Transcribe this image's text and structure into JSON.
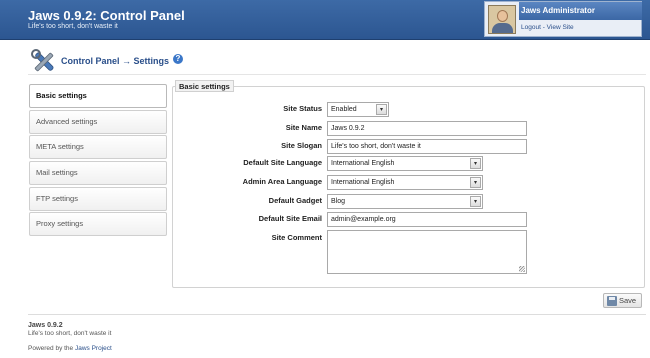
{
  "header": {
    "title": "Jaws 0.9.2: Control Panel",
    "slogan": "Life's too short, don't waste it"
  },
  "user": {
    "name": "Jaws Administrator",
    "logout": "Logout",
    "separator": " - ",
    "view_site": "View Site"
  },
  "breadcrumb": {
    "text": "Control Panel → Settings",
    "help_icon": "?"
  },
  "sidebar": {
    "items": [
      {
        "label": "Basic settings",
        "active": true
      },
      {
        "label": "Advanced settings",
        "active": false
      },
      {
        "label": "META settings",
        "active": false
      },
      {
        "label": "Mail settings",
        "active": false
      },
      {
        "label": "FTP settings",
        "active": false
      },
      {
        "label": "Proxy settings",
        "active": false
      }
    ]
  },
  "form": {
    "legend": "Basic settings",
    "fields": {
      "site_status": {
        "label": "Site Status",
        "value": "Enabled"
      },
      "site_name": {
        "label": "Site Name",
        "value": "Jaws 0.9.2"
      },
      "site_slogan": {
        "label": "Site Slogan",
        "value": "Life's too short, don't waste it"
      },
      "default_language": {
        "label": "Default Site Language",
        "value": "International English"
      },
      "admin_language": {
        "label": "Admin Area Language",
        "value": "International English"
      },
      "default_gadget": {
        "label": "Default Gadget",
        "value": "Blog"
      },
      "site_email": {
        "label": "Default Site Email",
        "value": "admin@example.org"
      },
      "site_comment": {
        "label": "Site Comment",
        "value": ""
      }
    },
    "save_label": "Save"
  },
  "footer": {
    "title": "Jaws 0.9.2",
    "slogan": "Life's too short, don't waste it",
    "powered_prefix": "Powered by the ",
    "powered_link": "Jaws Project"
  },
  "icons": {
    "select_arrow": "▾"
  },
  "colors": {
    "header": "#2c5691",
    "accent": "#2a4f8a"
  }
}
